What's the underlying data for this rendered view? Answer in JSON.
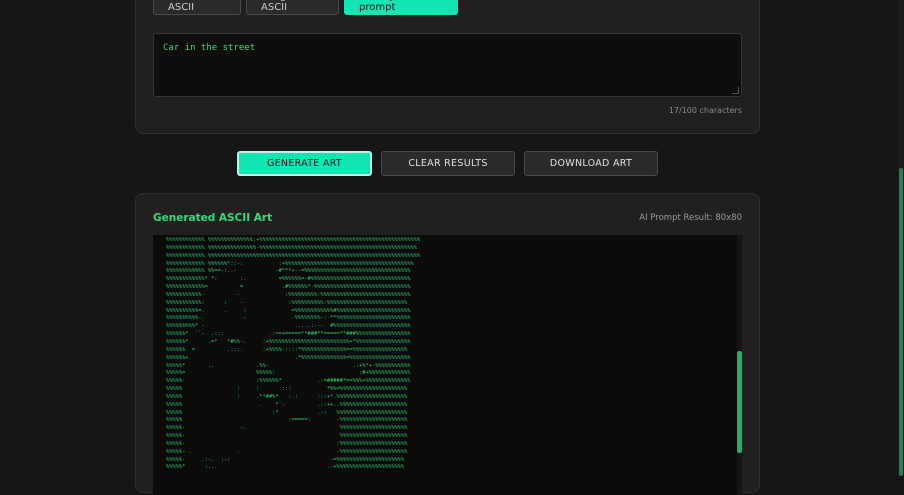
{
  "tabs": [
    {
      "label": "Text to ASCII",
      "active": false
    },
    {
      "label": "Image to ASCII",
      "active": false
    },
    {
      "label": "Enter your prompt",
      "active": true
    }
  ],
  "prompt": {
    "value": "Car in the street",
    "char_count": "17/100 characters"
  },
  "actions": {
    "generate": "GENERATE ART",
    "clear": "CLEAR RESULTS",
    "download": "DOWNLOAD ART"
  },
  "art": {
    "title": "Generated ASCII Art",
    "result_info": "AI Prompt Result: 80x80",
    "lines": [
      "%%%%%%%%%%%% %%%%%%%%%%%%%%:+%%%%%%%%%%%%%%%%%%%%%%%%%%%%%%%%%%%%%%%%%%%%%%%%%%",
      "%%%%%%%%%%%% %%%%%%%%%%%%%%%-%%%%%%%%%%%%%%%%%%%%%%%%%%%%%%%%%%%%%%%%%%%%%%%%%",
      "%%%%%%%%%%%% %%%%%%%%%%%%%%%%%%%%%%%%%%%%%%%%%%%%%%%%%%%%%%%%%%%%%%%%%%%%%%%%%%",
      "%%%%%%%%%%%% %%%%%%*::-:           :+%%%%%%%%%%%%%%%%%%%%%%%%%%%%%%%%%%%%%%%%",
      "%%%%%%%%%%%% %%==-:..-            -#***+--=%%%%%%%%%%%%%%%%%%%%%%%%%%%%%%%%%",
      "%%%%%%%%%%%%* *:       :.          =%%%%%%=-#%%%%%%%%%%%%%%%%%%%%%%%%%%%%%%%",
      "%%%%%%%%%%%%=          =            .#%%%%%%*-%%%%%%%%%%%%%%%%%%%%%%%%%%%%%%",
      "%%%%%%%%%%%-          -              :%%%%%%%%%:%%%%%%%%%%%%%%%%%%%%%%%%%%%%",
      "%%%%%%%%%%%:      :    -              :%%%%%%%%%%:%%%%%%%%%%%%%%%%%%%%%%%%%",
      "%%%%%%%%%%=.      .     :              =%%%%%%%%%%%%#%%%%%%%%%%%%%%%%%%%%%%%",
      "%%%%%%%%%%-.            -              -%%%%%%%%-:-**%%%%%%%%%%%%%%%%%%%%%%%",
      "%%%%%%%%%* -                            .....:---  #%%%%%%%%%%%%%%%%%%%%%%%%",
      "%%%%%%*  ``-  .:::              .:==+=====**###**=====**###%%%%%%%%%%%%%%%%%",
      "%%%%%%*      .=*   *#%%-.     :+%%%%%%%%%%%%%%%%%%%%%%%%%+*%%%%%%%%%%%%%%%%%",
      "%%%%%%  =          .:::.      :+%%%%-::::*%%%%%%%%%%%%%%==%%%%%%%%%%%%%%%%%",
      "%%%%%%+                                 .*%%%%%%%%%%%%%%=%%%%%%%%%%%%%%%%%%%",
      "%%%%%*       ..             .%%-                          .:+%*+-%%%%%%%%%%%",
      "%%%%%=                      %%%%%:                          :#+%%%%%%%%%%%%%",
      "%%%%%-                      :%%%%%%*           .:=#####*==%%%+%%%%%%%%%%%%%%",
      "%%%%%                 :     :       :::           *%%=%%%%%%%%%%%%%%%%%%%%%",
      "%%%%%                 :     .**##%*   :.:      :::+*.%%%%%%%%%%%%%%%%%%%%%%",
      "%%%%%                        .    *`-          .::++..%%%%%%%%%%%%%%%%%%%%%",
      "%%%%%                            :*            .-:   %%%%%%%%%%%%%%%%%%%%%%",
      "%%%%%                                 :=====:        -%%%%%%%%%%%%%%%%%%%%%",
      "%%%%%-                 -.                             %%%%%%%%%%%%%%%%%%%%%",
      "%%%%%-                                                %%%%%%%%%%%%%%%%%%%%%",
      "%%%%%-                                               :%%%%%%%%%%%%%%%%%%%%%",
      "%%%%%- .              .                              -%%%%%%%%%%%%%%%%%%%%%",
      "%%%%%-     .:-.  :-:                               -=%%%%%%%%%%%%%%%%%%%%%",
      "%%%%%*      :...                                  .-+%%%%%%%%%%%%%%%%%%%%%"
    ]
  },
  "colors": {
    "accent": "#10e6b4",
    "art_green": "#2fc96d",
    "title_green": "#3ad97b"
  }
}
